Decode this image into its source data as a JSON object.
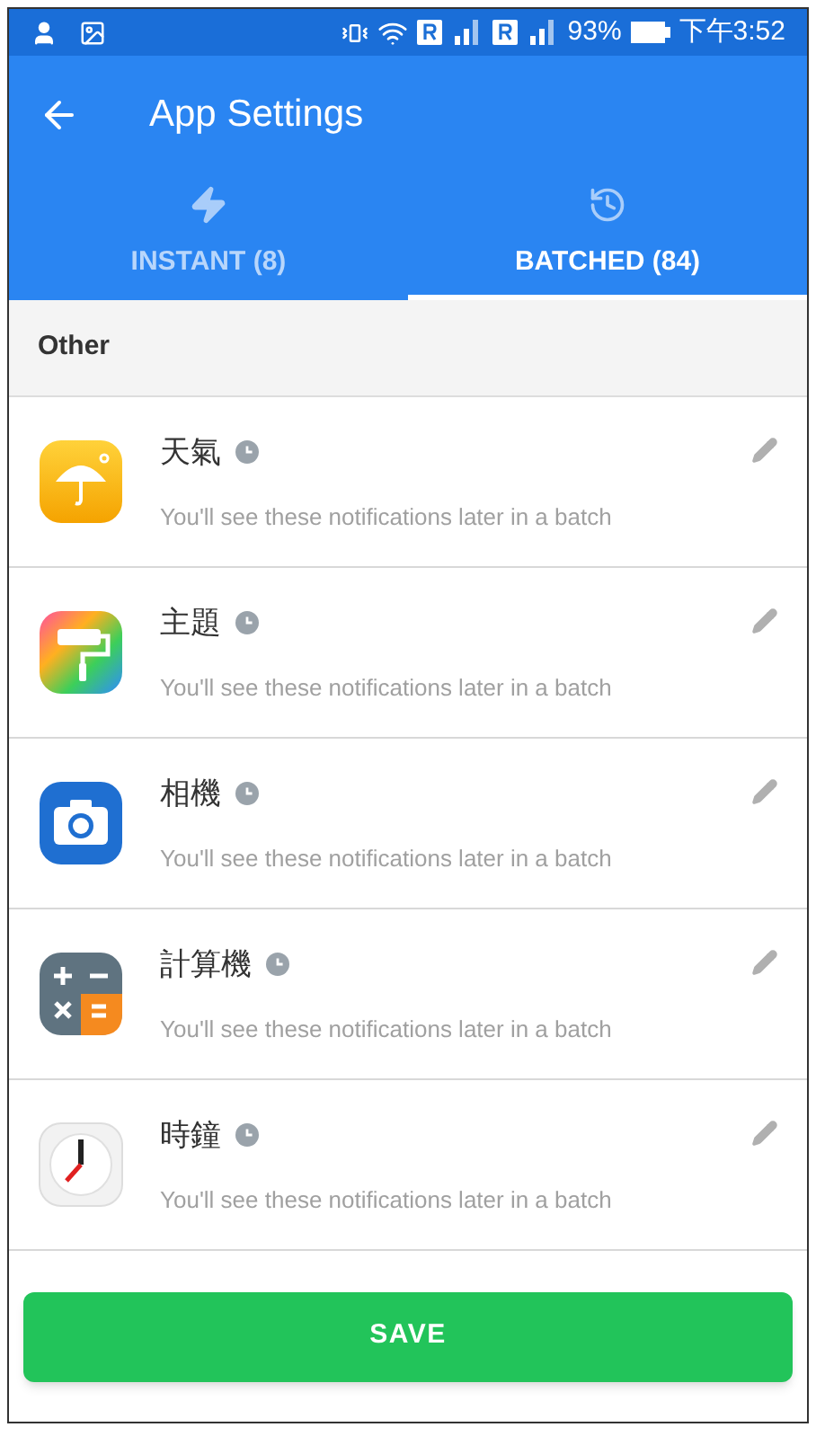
{
  "status_bar": {
    "battery": "93%",
    "time": "下午3:52"
  },
  "app_bar": {
    "title": "App Settings"
  },
  "tabs": [
    {
      "label": "INSTANT (8)",
      "kind": "instant",
      "selected": false
    },
    {
      "label": "BATCHED (84)",
      "kind": "batched",
      "selected": true
    }
  ],
  "section": {
    "title": "Other"
  },
  "apps": [
    {
      "name": "天氣",
      "kind": "weather",
      "subtitle": "You'll see these notifications later in a batch"
    },
    {
      "name": "主題",
      "kind": "themes",
      "subtitle": "You'll see these notifications later in a batch"
    },
    {
      "name": "相機",
      "kind": "camera",
      "subtitle": "You'll see these notifications later in a batch"
    },
    {
      "name": "計算機",
      "kind": "calculator",
      "subtitle": "You'll see these notifications later in a batch"
    },
    {
      "name": "時鐘",
      "kind": "clock",
      "subtitle": "You'll see these notifications later in a batch"
    }
  ],
  "save_button": {
    "label": "SAVE"
  }
}
